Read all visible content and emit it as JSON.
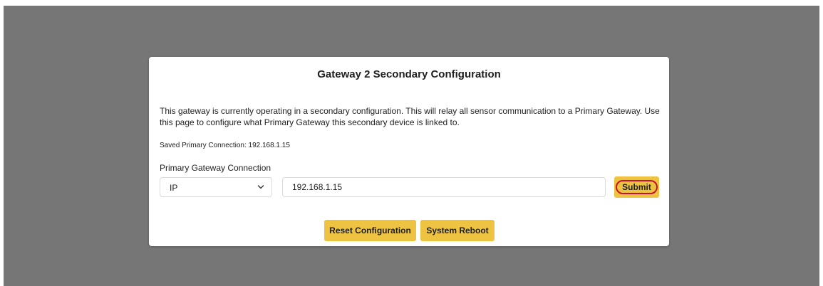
{
  "modal": {
    "title": "Gateway 2 Secondary Configuration",
    "description": "This gateway is currently operating in a secondary configuration. This will relay all sensor communication to a Primary Gateway. Use this page to configure what Primary Gateway this secondary device is linked to.",
    "saved_connection": "Saved Primary Connection: 192.168.1.15"
  },
  "form": {
    "label": "Primary Gateway Connection",
    "connection_type": {
      "selected": "IP",
      "icon": "chevron-down-icon"
    },
    "address_value": "192.168.1.15",
    "submit_label": "Submit",
    "submit_highlight_color": "#c8102e"
  },
  "actions": {
    "reset_label": "Reset Configuration",
    "reboot_label": "System Reboot"
  },
  "colors": {
    "backdrop": "#767676",
    "button": "#eec342"
  }
}
